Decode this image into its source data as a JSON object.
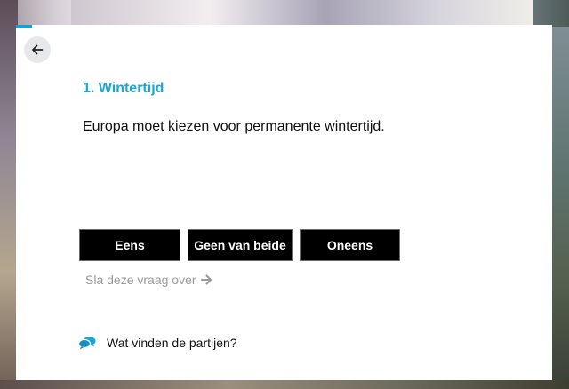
{
  "progress": {
    "value": 0.03,
    "color": "#12a3cf"
  },
  "navigation": {
    "back_icon": "arrow-left-icon"
  },
  "question": {
    "title": "1. Wintertijd",
    "statement": "Europa moet kiezen voor permanente wintertijd.",
    "title_color": "#1ba6d4"
  },
  "answers": {
    "agree": "Eens",
    "neither": "Geen van beide",
    "disagree": "Oneens"
  },
  "skip": {
    "label": "Sla deze vraag over",
    "icon": "arrow-right-icon"
  },
  "parties": {
    "label": "Wat vinden de partijen?",
    "icon": "chat-bubbles-icon"
  }
}
